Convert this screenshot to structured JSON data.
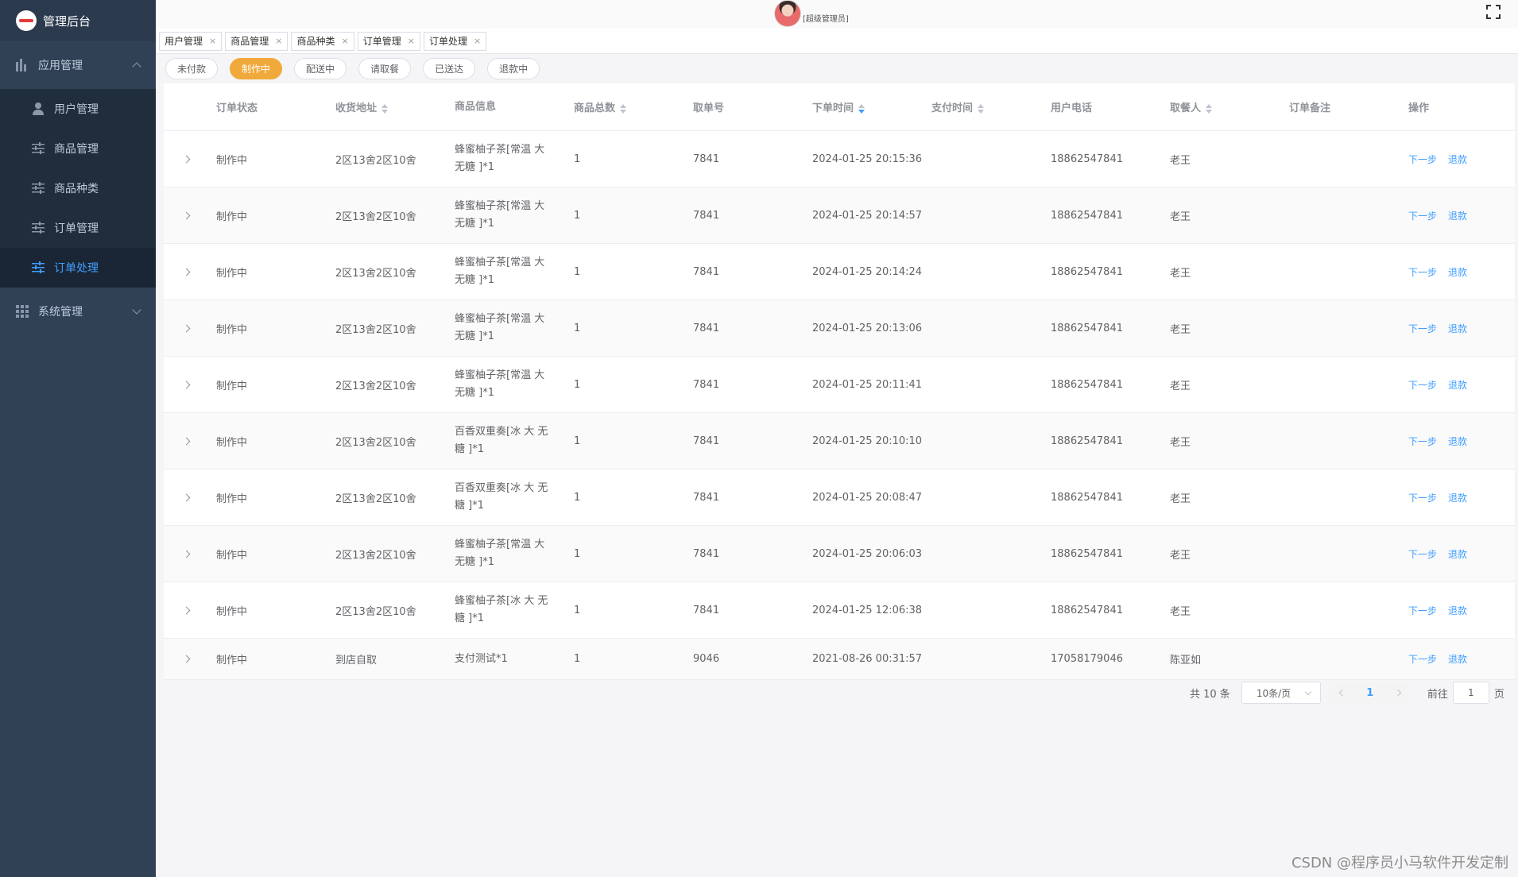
{
  "app": {
    "title": "管理后台"
  },
  "sidebar": {
    "group1": {
      "label": "应用管理"
    },
    "items": [
      {
        "label": "用户管理",
        "icon": "user-icon"
      },
      {
        "label": "商品管理",
        "icon": "sliders-icon"
      },
      {
        "label": "商品种类",
        "icon": "sliders-icon"
      },
      {
        "label": "订单管理",
        "icon": "sliders-icon"
      },
      {
        "label": "订单处理",
        "icon": "sliders-icon",
        "active": true
      }
    ],
    "group2": {
      "label": "系统管理"
    }
  },
  "header": {
    "role": "[超级管理员]"
  },
  "tags": [
    "用户管理",
    "商品管理",
    "商品种类",
    "订单管理",
    "订单处理"
  ],
  "filters": [
    "未付款",
    "制作中",
    "配送中",
    "请取餐",
    "已送达",
    "退款中"
  ],
  "table": {
    "columns": [
      "订单状态",
      "收货地址",
      "商品信息",
      "商品总数",
      "取单号",
      "下单时间",
      "支付时间",
      "用户电话",
      "取餐人",
      "订单备注",
      "操作"
    ],
    "rows": [
      {
        "status": "制作中",
        "address": "2区13舍2区10舍",
        "goods": "蜂蜜柚子茶[常温 大 无糖 ]*1",
        "total": "1",
        "pickup": "7841",
        "ordered": "2024-01-25 20:15:36",
        "paid": "",
        "phone": "18862547841",
        "receiver": "老王",
        "note": ""
      },
      {
        "status": "制作中",
        "address": "2区13舍2区10舍",
        "goods": "蜂蜜柚子茶[常温 大 无糖 ]*1",
        "total": "1",
        "pickup": "7841",
        "ordered": "2024-01-25 20:14:57",
        "paid": "",
        "phone": "18862547841",
        "receiver": "老王",
        "note": ""
      },
      {
        "status": "制作中",
        "address": "2区13舍2区10舍",
        "goods": "蜂蜜柚子茶[常温 大 无糖 ]*1",
        "total": "1",
        "pickup": "7841",
        "ordered": "2024-01-25 20:14:24",
        "paid": "",
        "phone": "18862547841",
        "receiver": "老王",
        "note": ""
      },
      {
        "status": "制作中",
        "address": "2区13舍2区10舍",
        "goods": "蜂蜜柚子茶[常温 大 无糖 ]*1",
        "total": "1",
        "pickup": "7841",
        "ordered": "2024-01-25 20:13:06",
        "paid": "",
        "phone": "18862547841",
        "receiver": "老王",
        "note": ""
      },
      {
        "status": "制作中",
        "address": "2区13舍2区10舍",
        "goods": "蜂蜜柚子茶[常温 大 无糖 ]*1",
        "total": "1",
        "pickup": "7841",
        "ordered": "2024-01-25 20:11:41",
        "paid": "",
        "phone": "18862547841",
        "receiver": "老王",
        "note": ""
      },
      {
        "status": "制作中",
        "address": "2区13舍2区10舍",
        "goods": "百香双重奏[冰 大 无糖 ]*1",
        "total": "1",
        "pickup": "7841",
        "ordered": "2024-01-25 20:10:10",
        "paid": "",
        "phone": "18862547841",
        "receiver": "老王",
        "note": ""
      },
      {
        "status": "制作中",
        "address": "2区13舍2区10舍",
        "goods": "百香双重奏[冰 大 无糖 ]*1",
        "total": "1",
        "pickup": "7841",
        "ordered": "2024-01-25 20:08:47",
        "paid": "",
        "phone": "18862547841",
        "receiver": "老王",
        "note": ""
      },
      {
        "status": "制作中",
        "address": "2区13舍2区10舍",
        "goods": "蜂蜜柚子茶[常温 大 无糖 ]*1",
        "total": "1",
        "pickup": "7841",
        "ordered": "2024-01-25 20:06:03",
        "paid": "",
        "phone": "18862547841",
        "receiver": "老王",
        "note": ""
      },
      {
        "status": "制作中",
        "address": "2区13舍2区10舍",
        "goods": "蜂蜜柚子茶[冰 大 无糖 ]*1",
        "total": "1",
        "pickup": "7841",
        "ordered": "2024-01-25 12:06:38",
        "paid": "",
        "phone": "18862547841",
        "receiver": "老王",
        "note": ""
      },
      {
        "status": "制作中",
        "address": "到店自取",
        "goods": "支付测试*1",
        "total": "1",
        "pickup": "9046",
        "ordered": "2021-08-26 00:31:57",
        "paid": "",
        "phone": "17058179046",
        "receiver": "陈亚如",
        "note": ""
      }
    ],
    "actions": {
      "next": "下一步",
      "refund": "退款"
    }
  },
  "pagination": {
    "total_text": "共 10 条",
    "page_size": "10条/页",
    "current_page": "1",
    "goto_label": "前往",
    "goto_value": "1",
    "page_suffix": "页"
  },
  "watermark": "CSDN @程序员小马软件开发定制",
  "colors": {
    "sidebar_bg": "#304156",
    "accent": "#409eff",
    "active_filter": "#f0a93b"
  }
}
